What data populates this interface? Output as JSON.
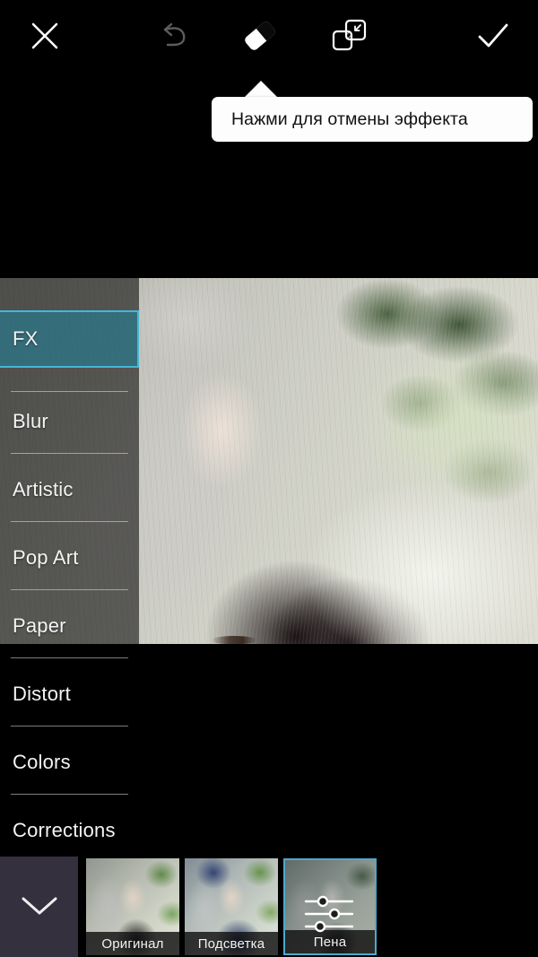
{
  "toolbar": {
    "buttons": [
      {
        "name": "close",
        "icon": "close-icon",
        "label": "Close"
      },
      {
        "name": "undo",
        "icon": "undo-icon",
        "label": "Undo"
      },
      {
        "name": "eraser",
        "icon": "eraser-icon",
        "label": "Eraser"
      },
      {
        "name": "mask",
        "icon": "mask-overlap-icon",
        "label": "Mask"
      },
      {
        "name": "confirm",
        "icon": "checkmark-icon",
        "label": "Apply"
      }
    ]
  },
  "tooltip": {
    "text": "Нажми для отмены эффекта"
  },
  "sidebar": {
    "items": [
      {
        "label": "FX",
        "selected": true
      },
      {
        "label": "Blur",
        "selected": false
      },
      {
        "label": "Artistic",
        "selected": false
      },
      {
        "label": "Pop Art",
        "selected": false
      },
      {
        "label": "Paper",
        "selected": false
      },
      {
        "label": "Distort",
        "selected": false
      },
      {
        "label": "Colors",
        "selected": false
      },
      {
        "label": "Corrections",
        "selected": false
      }
    ],
    "accent_color": "#46b6d6",
    "highlight_fill": "rgba(36,126,150,0.62)"
  },
  "filmstrip": {
    "collapse_icon": "chevron-down-icon",
    "thumbnails": [
      {
        "label": "Оригинал",
        "selected": false,
        "has_settings_icon": false
      },
      {
        "label": "Подсветка",
        "selected": false,
        "has_settings_icon": false
      },
      {
        "label": "Пена",
        "selected": true,
        "has_settings_icon": true,
        "settings_icon": "sliders-icon"
      }
    ],
    "selected_border_color": "#4ea8cf",
    "panel_color": "#35303e"
  },
  "canvas": {
    "image_description": "photo-of-woman-with-silver-hair"
  }
}
